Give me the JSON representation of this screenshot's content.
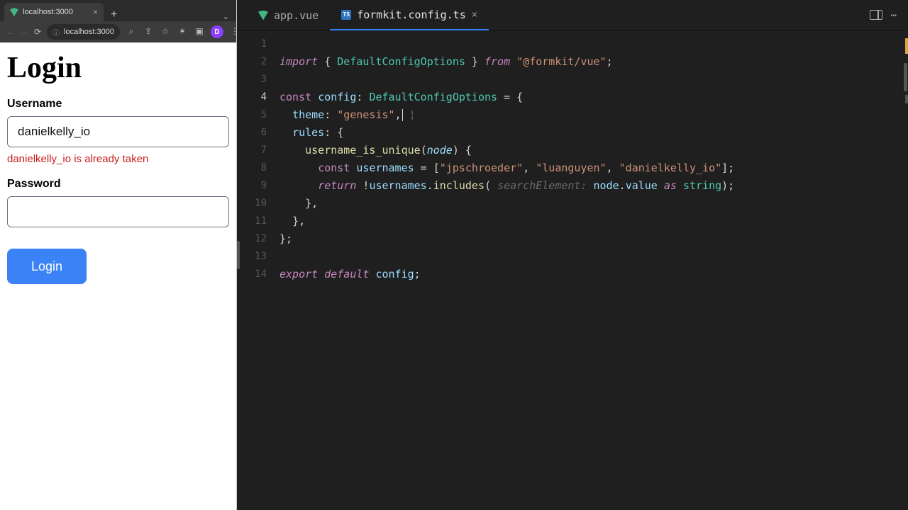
{
  "browser": {
    "tab": {
      "title": "localhost:3000"
    },
    "address": "localhost:3000",
    "avatar_letter": "D"
  },
  "page": {
    "heading": "Login",
    "username_label": "Username",
    "username_value": "danielkelly_io",
    "username_error": "danielkelly_io is already taken",
    "password_label": "Password",
    "password_value": "",
    "submit_label": "Login"
  },
  "editor": {
    "tabs": [
      {
        "label": "app.vue",
        "icon": "vue",
        "active": false
      },
      {
        "label": "formkit.config.ts",
        "icon": "ts",
        "active": true
      }
    ],
    "ts_badge": "TS",
    "line_numbers": [
      "1",
      "2",
      "3",
      "4",
      "5",
      "6",
      "7",
      "8",
      "9",
      "10",
      "11",
      "12",
      "13",
      "14"
    ],
    "current_line_index": 3,
    "code": {
      "l1": {
        "import": "import",
        "lbrace": " { ",
        "type": "DefaultConfigOptions",
        "rbrace": " } ",
        "from": "from",
        "pkg": "\"@formkit/vue\"",
        "semi": ";"
      },
      "l3": {
        "const": "const",
        "name": "config",
        "colon": ": ",
        "type": "DefaultConfigOptions",
        "eq": " = {"
      },
      "l4": {
        "indent": "  ",
        "key": "theme",
        "sep": ": ",
        "val": "\"genesis\"",
        "comma": ",",
        "cursor_char": "¦"
      },
      "l5": {
        "indent": "  ",
        "key": "rules",
        "sep": ": {"
      },
      "l6": {
        "indent": "    ",
        "fn": "username_is_unique",
        "lp": "(",
        "param": "node",
        "rp": ") {"
      },
      "l7": {
        "indent": "      ",
        "const": "const",
        "name": "usernames",
        "eq": " = [",
        "s1": "\"jpschroeder\"",
        "c1": ", ",
        "s2": "\"luanguyen\"",
        "c2": ", ",
        "s3": "\"danielkelly_io\"",
        "end": "];"
      },
      "l8": {
        "indent": "      ",
        "ret": "return",
        "sp": " !",
        "obj": "usernames",
        "dot": ".",
        "fn": "includes",
        "lp": "( ",
        "hint": "searchElement:",
        "sp2": " ",
        "node": "node",
        "dot2": ".",
        "val": "value",
        "sp3": " ",
        "as": "as",
        "sp4": " ",
        "type": "string",
        "rp": ");"
      },
      "l9": {
        "indent": "    ",
        "brace": "},"
      },
      "l10": {
        "indent": "  ",
        "brace": "},"
      },
      "l11": {
        "brace": "};"
      },
      "l13": {
        "export": "export",
        "sp": " ",
        "default": "default",
        "sp2": " ",
        "name": "config",
        "semi": ";"
      }
    }
  }
}
